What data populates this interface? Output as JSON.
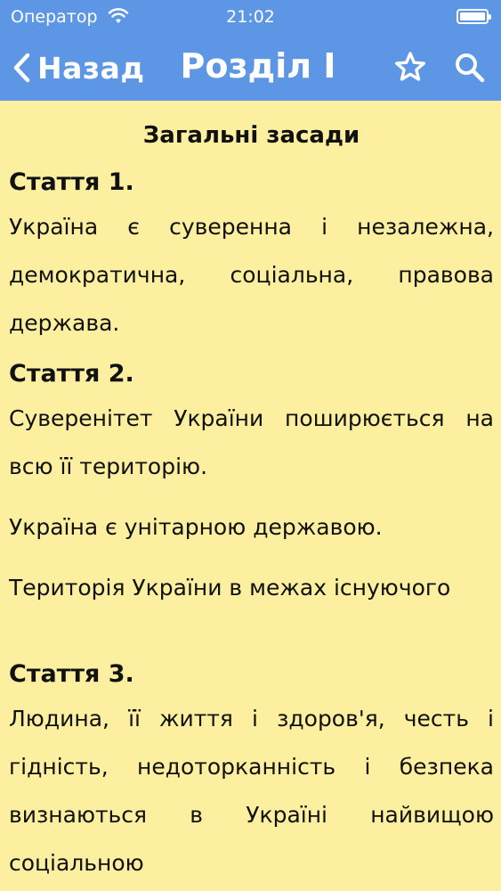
{
  "status_bar": {
    "carrier": "Оператор",
    "time": "21:02"
  },
  "nav": {
    "back_label": "Назад",
    "title": "Розділ I",
    "icons": [
      "chevron-left-icon",
      "star-icon",
      "search-icon"
    ]
  },
  "content": {
    "section_title": "Загальні засади",
    "articles": [
      {
        "heading": "Стаття 1.",
        "paragraphs": [
          "Україна є суверенна і незалежна, демократична, соціальна, правова держава."
        ]
      },
      {
        "heading": "Стаття 2.",
        "paragraphs": [
          "Суверенітет України поширюється на всю її територію.",
          "Україна є унітарною державою.",
          "Територія України в межах існуючого"
        ]
      },
      {
        "heading": "Стаття 3.",
        "paragraphs": [
          "Людина, її життя і здоров'я, честь і гідність, недоторканність і безпека визнаються в Україні найвищою соціальною"
        ]
      }
    ]
  },
  "colors": {
    "header": "#5d96e4",
    "background": "#fcef9f",
    "text": "#111111"
  }
}
